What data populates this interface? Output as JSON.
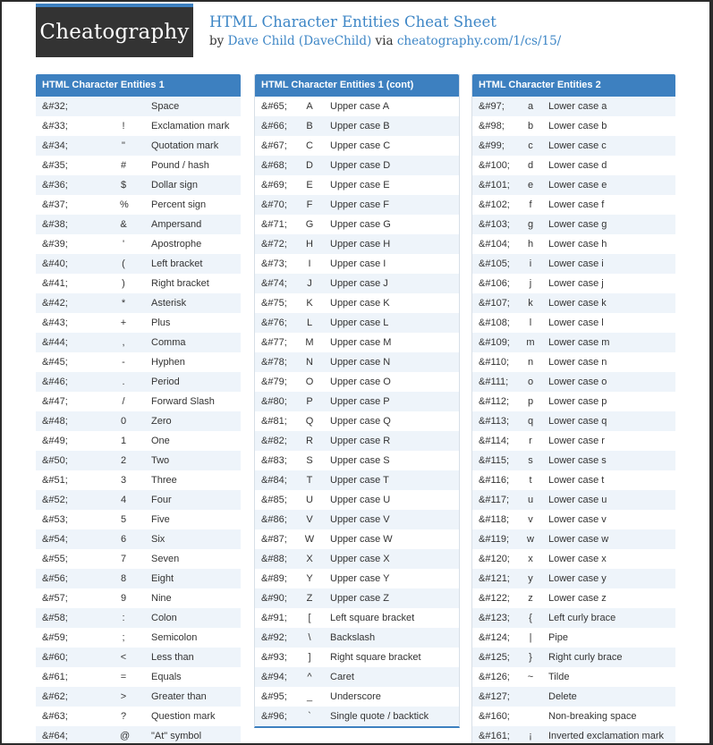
{
  "header": {
    "logo_text": "Cheatography",
    "title": "HTML Character Entities Cheat Sheet",
    "by_prefix": "by ",
    "author": "Dave Child (DaveChild)",
    "via": " via ",
    "url": "cheatography.com/1/cs/15/"
  },
  "colors": {
    "accent": "#3d80c0",
    "row_shade": "#eef4fa",
    "logo_bg": "#333333"
  },
  "columns": [
    {
      "title": "HTML Character Entities 1",
      "first_shaded": true,
      "rows": [
        [
          "&#32;",
          "",
          "Space"
        ],
        [
          "&#33;",
          "!",
          "Exclamation mark"
        ],
        [
          "&#34;",
          "\"",
          "Quotation mark"
        ],
        [
          "&#35;",
          "#",
          "Pound / hash"
        ],
        [
          "&#36;",
          "$",
          "Dollar sign"
        ],
        [
          "&#37;",
          "%",
          "Percent sign"
        ],
        [
          "&#38;",
          "&",
          "Ampersand"
        ],
        [
          "&#39;",
          "'",
          "Apostrophe"
        ],
        [
          "&#40;",
          "(",
          "Left bracket"
        ],
        [
          "&#41;",
          ")",
          "Right bracket"
        ],
        [
          "&#42;",
          "*",
          "Asterisk"
        ],
        [
          "&#43;",
          "+",
          "Plus"
        ],
        [
          "&#44;",
          ",",
          "Comma"
        ],
        [
          "&#45;",
          "-",
          "Hyphen"
        ],
        [
          "&#46;",
          ".",
          "Period"
        ],
        [
          "&#47;",
          "/",
          "Forward Slash"
        ],
        [
          "&#48;",
          "0",
          "Zero"
        ],
        [
          "&#49;",
          "1",
          "One"
        ],
        [
          "&#50;",
          "2",
          "Two"
        ],
        [
          "&#51;",
          "3",
          "Three"
        ],
        [
          "&#52;",
          "4",
          "Four"
        ],
        [
          "&#53;",
          "5",
          "Five"
        ],
        [
          "&#54;",
          "6",
          "Six"
        ],
        [
          "&#55;",
          "7",
          "Seven"
        ],
        [
          "&#56;",
          "8",
          "Eight"
        ],
        [
          "&#57;",
          "9",
          "Nine"
        ],
        [
          "&#58;",
          ":",
          "Colon"
        ],
        [
          "&#59;",
          ";",
          "Semicolon"
        ],
        [
          "&#60;",
          "<",
          "Less than"
        ],
        [
          "&#61;",
          "=",
          "Equals"
        ],
        [
          "&#62;",
          ">",
          "Greater than"
        ],
        [
          "&#63;",
          "?",
          "Question mark"
        ],
        [
          "&#64;",
          "@",
          "\"At\" symbol"
        ]
      ]
    },
    {
      "title": "HTML Character Entities 1 (cont)",
      "first_shaded": false,
      "rows": [
        [
          "&#65;",
          "A",
          "Upper case A"
        ],
        [
          "&#66;",
          "B",
          "Upper case B"
        ],
        [
          "&#67;",
          "C",
          "Upper case C"
        ],
        [
          "&#68;",
          "D",
          "Upper case D"
        ],
        [
          "&#69;",
          "E",
          "Upper case E"
        ],
        [
          "&#70;",
          "F",
          "Upper case F"
        ],
        [
          "&#71;",
          "G",
          "Upper case G"
        ],
        [
          "&#72;",
          "H",
          "Upper case H"
        ],
        [
          "&#73;",
          "I",
          "Upper case I"
        ],
        [
          "&#74;",
          "J",
          "Upper case J"
        ],
        [
          "&#75;",
          "K",
          "Upper case K"
        ],
        [
          "&#76;",
          "L",
          "Upper case L"
        ],
        [
          "&#77;",
          "M",
          "Upper case M"
        ],
        [
          "&#78;",
          "N",
          "Upper case N"
        ],
        [
          "&#79;",
          "O",
          "Upper case O"
        ],
        [
          "&#80;",
          "P",
          "Upper case P"
        ],
        [
          "&#81;",
          "Q",
          "Upper case Q"
        ],
        [
          "&#82;",
          "R",
          "Upper case R"
        ],
        [
          "&#83;",
          "S",
          "Upper case S"
        ],
        [
          "&#84;",
          "T",
          "Upper case T"
        ],
        [
          "&#85;",
          "U",
          "Upper case U"
        ],
        [
          "&#86;",
          "V",
          "Upper case V"
        ],
        [
          "&#87;",
          "W",
          "Upper case W"
        ],
        [
          "&#88;",
          "X",
          "Upper case X"
        ],
        [
          "&#89;",
          "Y",
          "Upper case Y"
        ],
        [
          "&#90;",
          "Z",
          "Upper case Z"
        ],
        [
          "&#91;",
          "[",
          "Left square bracket"
        ],
        [
          "&#92;",
          "\\",
          "Backslash"
        ],
        [
          "&#93;",
          "]",
          "Right square bracket"
        ],
        [
          "&#94;",
          "^",
          "Caret"
        ],
        [
          "&#95;",
          "_",
          "Underscore"
        ],
        [
          "&#96;",
          "`",
          "Single quote / backtick"
        ]
      ]
    },
    {
      "title": "HTML Character Entities 2",
      "first_shaded": true,
      "rows": [
        [
          "&#97;",
          "a",
          "Lower case a"
        ],
        [
          "&#98;",
          "b",
          "Lower case b"
        ],
        [
          "&#99;",
          "c",
          "Lower case c"
        ],
        [
          "&#100;",
          "d",
          "Lower case d"
        ],
        [
          "&#101;",
          "e",
          "Lower case e"
        ],
        [
          "&#102;",
          "f",
          "Lower case f"
        ],
        [
          "&#103;",
          "g",
          "Lower case g"
        ],
        [
          "&#104;",
          "h",
          "Lower case h"
        ],
        [
          "&#105;",
          "i",
          "Lower case i"
        ],
        [
          "&#106;",
          "j",
          "Lower case j"
        ],
        [
          "&#107;",
          "k",
          "Lower case k"
        ],
        [
          "&#108;",
          "l",
          "Lower case l"
        ],
        [
          "&#109;",
          "m",
          "Lower case m"
        ],
        [
          "&#110;",
          "n",
          "Lower case n"
        ],
        [
          "&#111;",
          "o",
          "Lower case o"
        ],
        [
          "&#112;",
          "p",
          "Lower case p"
        ],
        [
          "&#113;",
          "q",
          "Lower case q"
        ],
        [
          "&#114;",
          "r",
          "Lower case r"
        ],
        [
          "&#115;",
          "s",
          "Lower case s"
        ],
        [
          "&#116;",
          "t",
          "Lower case t"
        ],
        [
          "&#117;",
          "u",
          "Lower case u"
        ],
        [
          "&#118;",
          "v",
          "Lower case v"
        ],
        [
          "&#119;",
          "w",
          "Lower case w"
        ],
        [
          "&#120;",
          "x",
          "Lower case x"
        ],
        [
          "&#121;",
          "y",
          "Lower case y"
        ],
        [
          "&#122;",
          "z",
          "Lower case z"
        ],
        [
          "&#123;",
          "{",
          "Left curly brace"
        ],
        [
          "&#124;",
          "|",
          "Pipe"
        ],
        [
          "&#125;",
          "}",
          "Right curly brace"
        ],
        [
          "&#126;",
          "~",
          "Tilde"
        ],
        [
          "&#127;",
          "",
          "Delete"
        ],
        [
          "&#160;",
          "",
          "Non-breaking space"
        ],
        [
          "&#161;",
          "¡",
          "Inverted exclamation mark"
        ]
      ]
    }
  ]
}
